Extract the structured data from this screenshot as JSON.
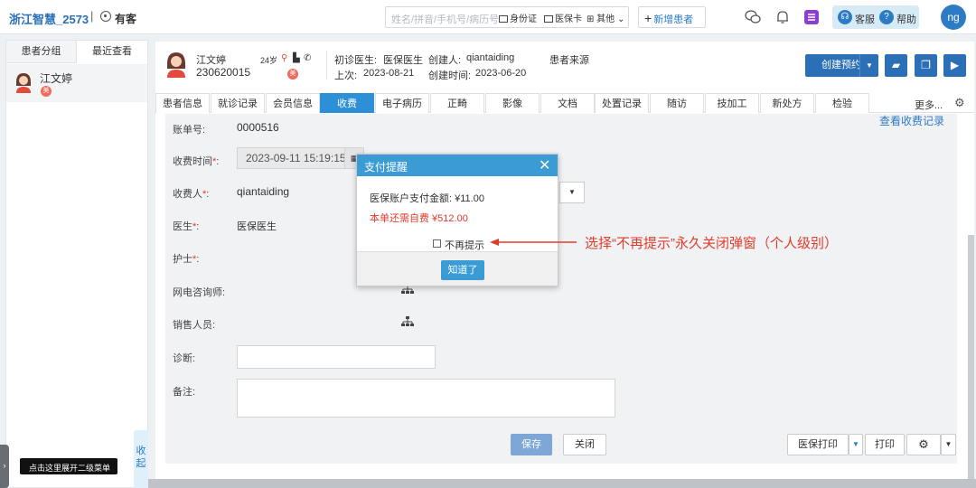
{
  "app": {
    "title": "浙江智慧_2573",
    "separator": "|",
    "sub": "有客"
  },
  "search": {
    "placeholder": "姓名/拼音/手机号/病历号",
    "options": [
      "身份证",
      "医保卡",
      "其他"
    ]
  },
  "new_patient": "新增患者",
  "support": {
    "service": "客服",
    "help": "帮助"
  },
  "user_initials": "ng",
  "left_panel": {
    "tabs": [
      "患者分组",
      "最近查看"
    ],
    "patient": {
      "name": "江文婷",
      "badge": "美"
    },
    "collapse": "收起",
    "expand_hint": "点击这里展开二级菜单"
  },
  "patient_header": {
    "name": "江文婷",
    "id": "230620015",
    "age": "24岁",
    "badge": "美",
    "first_doctor_label": "初诊医生:",
    "first_doctor": "医保医生",
    "creator_label": "创建人:",
    "creator": "qiantaiding",
    "last_visit_label": "上次:",
    "last_visit": "2023-08-21",
    "created_time_label": "创建时间:",
    "created_time": "2023-06-20",
    "source_label": "患者来源",
    "book_button": "创建预约"
  },
  "tabs": [
    "患者信息",
    "就诊记录",
    "会员信息",
    "收费",
    "电子病历",
    "正畸",
    "影像",
    "文档",
    "处置记录",
    "随访",
    "技加工",
    "新处方",
    "检验"
  ],
  "active_tab": "收费",
  "more_tabs": "更多...",
  "form": {
    "view_records": "查看收费记录",
    "bill_no_label": "账单号:",
    "bill_no": "0000516",
    "charge_time_label": "收费时间",
    "charge_time": "2023-09-11 15:19:15",
    "payee_label": "收费人",
    "payee": "qiantaiding",
    "doctor_label": "医生",
    "doctor": "医保医生",
    "nurse_label": "护士",
    "consultant_label": "网电咨询师:",
    "sales_label": "销售人员:",
    "diagnosis_label": "诊断:",
    "note_label": "备注:",
    "req_mark": "*",
    "colon": ":"
  },
  "buttons": {
    "save": "保存",
    "close": "关闭",
    "insurance_print": "医保打印",
    "print": "打印"
  },
  "modal": {
    "title": "支付提醒",
    "insurance_paid": "医保账户支付金额: ¥11.00",
    "self_pay": "本单还需自费 ¥512.00",
    "dont_remind": "不再提示",
    "ok": "知道了"
  },
  "annotation": "选择“不再提示”永久关闭弹窗（个人级别）",
  "colors": {
    "primary": "#2b6fb6",
    "tab_active": "#2d8fd5",
    "modal_header": "#3a9bd5",
    "alert": "#e03b2b"
  }
}
